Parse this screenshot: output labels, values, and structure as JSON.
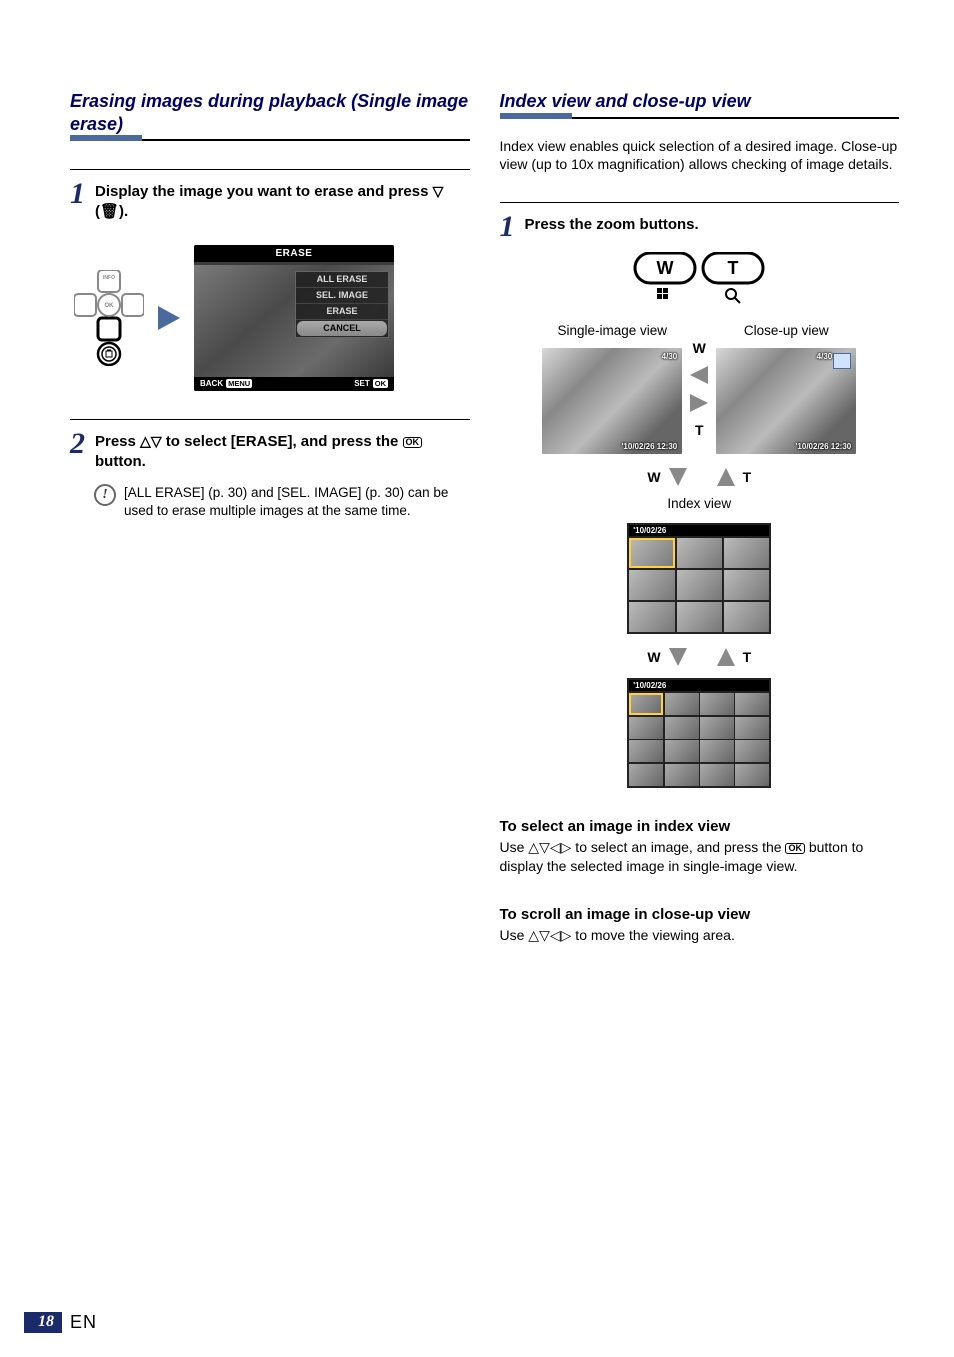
{
  "left": {
    "title": "Erasing images during playback (Single image erase)",
    "step1": {
      "num": "1",
      "text_a": "Display the image you want to erase and press ",
      "text_b": " (",
      "text_c": ")."
    },
    "arrowpad": {
      "info": "INFO",
      "ok": "OK"
    },
    "screen": {
      "title": "ERASE",
      "menu": [
        "ALL ERASE",
        "SEL. IMAGE",
        "ERASE",
        "CANCEL"
      ],
      "back": "BACK",
      "back_badge": "MENU",
      "set": "SET",
      "set_badge": "OK"
    },
    "step2": {
      "num": "2",
      "text_a": "Press ",
      "text_b": " to select [ERASE], and press the ",
      "text_c": " button."
    },
    "note": "[ALL ERASE] (p. 30) and [SEL. IMAGE] (p. 30) can be used to erase multiple images at the same time."
  },
  "right": {
    "title": "Index view and close-up view",
    "intro": "Index view enables quick selection of a desired image. Close-up view (up to 10x magnification) allows checking of image details.",
    "step1": {
      "num": "1",
      "text": "Press the zoom buttons."
    },
    "zoom": {
      "w": "W",
      "t": "T"
    },
    "single_label": "Single-image view",
    "closeup_label": "Close-up view",
    "overlay_count": "4/30",
    "overlay_time": "'10/02/26 12:30",
    "wt_up": "W",
    "wt_dn": "T",
    "index_label": "Index view",
    "idx_date": "'10/02/26",
    "sub1_h": "To select an image in index view",
    "sub1_a": "Use ",
    "sub1_b": " to select an image, and press the ",
    "sub1_c": " button to display the selected image in single-image view.",
    "sub2_h": "To scroll an image in close-up view",
    "sub2_a": "Use ",
    "sub2_b": " to move the viewing area."
  },
  "footer": {
    "page": "18",
    "lang": "EN"
  }
}
